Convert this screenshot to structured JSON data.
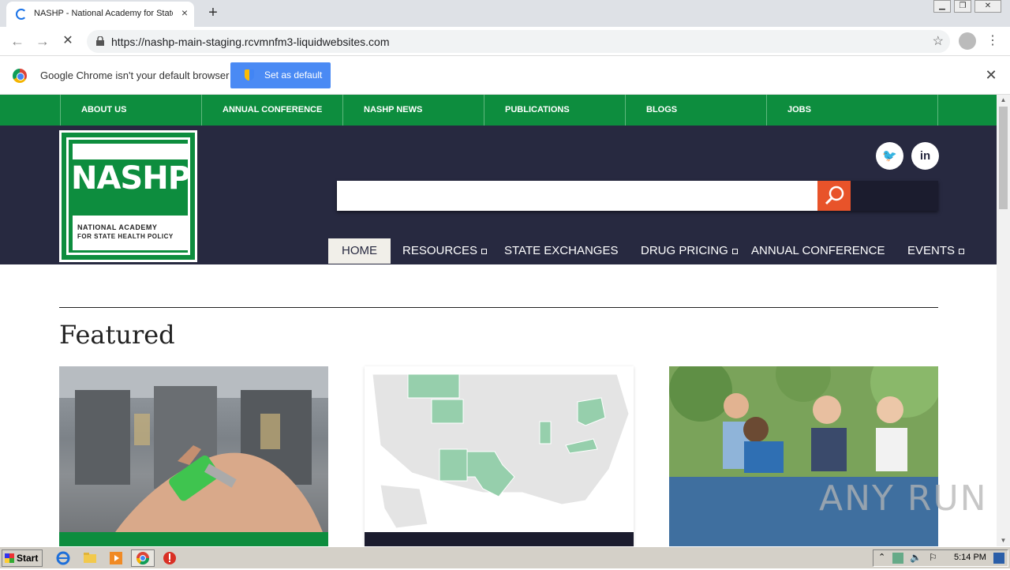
{
  "browser": {
    "tab_title": "NASHP - National Academy for State Health Policy",
    "tab_close": "×",
    "new_tab": "+",
    "url": "https://nashp-main-staging.rcvmnfm3-liquidwebsites.com",
    "back": "←",
    "forward": "→",
    "reload": "✕",
    "star": "☆",
    "menu": "⋮",
    "win_min": "▁",
    "win_max": "❐",
    "win_close": "✕"
  },
  "infobar": {
    "message": "Google Chrome isn't your default browser",
    "button": "Set as default",
    "close": "✕"
  },
  "site": {
    "topnav": [
      "ABOUT US",
      "ANNUAL CONFERENCE",
      "NASHP NEWS",
      "PUBLICATIONS",
      "BLOGS",
      "JOBS"
    ],
    "logo": {
      "title": "NASHP",
      "line1": "NATIONAL ACADEMY",
      "line2": "FOR STATE HEALTH POLICY"
    },
    "social": {
      "twitter": "🐦",
      "linkedin": "in"
    },
    "search_placeholder": "",
    "mainnav": {
      "home": "HOME",
      "resources": "RESOURCES",
      "state_exchanges": "STATE EXCHANGES",
      "drug_pricing": "DRUG PRICING",
      "annual_conference": "ANNUAL CONFERENCE",
      "events": "EVENTS"
    },
    "featured_heading": "Featured"
  },
  "taskbar": {
    "start": "Start",
    "clock": "5:14 PM"
  },
  "watermark": "ANY RUN",
  "colors": {
    "green": "#0d8d3e",
    "navy": "#272940",
    "search_orange": "#e8532a",
    "card_blue": "#3f6f9f"
  }
}
